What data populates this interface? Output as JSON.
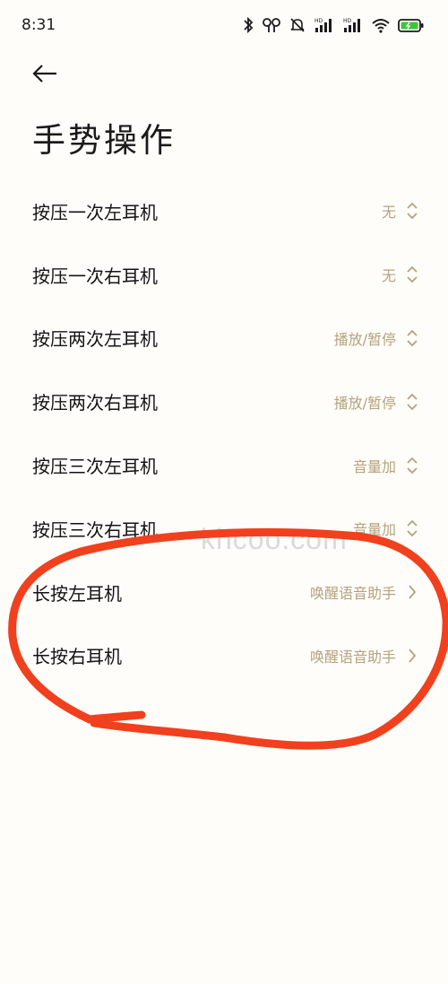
{
  "status_bar": {
    "time": "8:31",
    "battery_color": "#3ec43e"
  },
  "header": {
    "title": "手势操作"
  },
  "settings": [
    {
      "label": "按压一次左耳机",
      "value": "无",
      "control": "chevron-up-down-icon"
    },
    {
      "label": "按压一次右耳机",
      "value": "无",
      "control": "chevron-up-down-icon"
    },
    {
      "label": "按压两次左耳机",
      "value": "播放/暂停",
      "control": "chevron-up-down-icon"
    },
    {
      "label": "按压两次右耳机",
      "value": "播放/暂停",
      "control": "chevron-up-down-icon"
    },
    {
      "label": "按压三次左耳机",
      "value": "音量加",
      "control": "chevron-up-down-icon"
    },
    {
      "label": "按压三次右耳机",
      "value": "音量加",
      "control": "chevron-up-down-icon"
    },
    {
      "label": "长按左耳机",
      "value": "唤醒语音助手",
      "control": "chevron-right-icon"
    },
    {
      "label": "长按右耳机",
      "value": "唤醒语音助手",
      "control": "chevron-right-icon"
    }
  ],
  "watermark": "khcoo.com",
  "colors": {
    "accent": "#b4a27f",
    "annotation": "#f1401d",
    "background": "#fffdf9"
  }
}
